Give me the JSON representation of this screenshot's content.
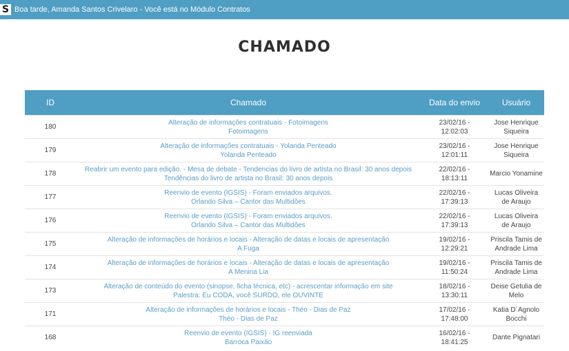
{
  "header": {
    "logo_text": "S",
    "greeting": "Boa tarde, Amanda Santos Crivelaro - Você está no Módulo Contratos"
  },
  "page": {
    "title": "CHAMADO"
  },
  "table": {
    "columns": [
      "ID",
      "Chamado",
      "Data do envio",
      "Usuário"
    ],
    "rows": [
      {
        "id": "180",
        "line1": "Alteração de informações contratuais - Fotoimagens",
        "line2": "Fotoimagens",
        "date": "23/02/16 -",
        "time": "12:02:03",
        "user": "Jose Henrique Siqueira"
      },
      {
        "id": "179",
        "line1": "Alteração de informações contratuais - Yolanda Penteado",
        "line2": "Yolanda Penteado",
        "date": "23/02/16 -",
        "time": "12:01:11",
        "user": "Jose Henrique Siqueira"
      },
      {
        "id": "178",
        "line1": "Reabrir um evento para edição. - Mesa de debate - Tendencias do livro de artista no Brasil: 30 anos depois",
        "line2": "Tendências do livro de artista no Brasil: 30 anos depois",
        "date": "22/02/16 -",
        "time": "18:13:11",
        "user": "Marcio Yonamine"
      },
      {
        "id": "177",
        "line1": "Reenvio de evento (IGSIS) - Foram enviados arquivos.",
        "line2": "Orlando Silva – Cantor das Multidões",
        "date": "22/02/16 -",
        "time": "17:39:13",
        "user": "Lucas Oliveira de Araujo"
      },
      {
        "id": "176",
        "line1": "Reenvio de evento (IGSIS) - Foram enviados arquivos.",
        "line2": "Orlando Silva – Cantor das Multidões",
        "date": "22/02/16 -",
        "time": "17:39:13",
        "user": "Lucas Oliveira de Araujo"
      },
      {
        "id": "175",
        "line1": "Alteração de informações de horários e locais - Alteração de datas e locais de apresentação",
        "line2": "A Fuga",
        "date": "19/02/16 -",
        "time": "12:29:21",
        "user": "Priscila Tamis de Andrade Lima"
      },
      {
        "id": "174",
        "line1": "Alteração de informações de horários e locais - Alteração de datas e locais de apresentação",
        "line2": "A Menina Lia",
        "date": "19/02/16 -",
        "time": "11:50:24",
        "user": "Priscila Tamis de Andrade Lima"
      },
      {
        "id": "173",
        "line1": "Alteração de conteúdo do evento (sinopse, ficha técnica, etc) - acrescentar informação em site",
        "line2": "Palestra: Eu CODA, você SURDO, ele OUVINTE",
        "date": "18/02/16 -",
        "time": "13:30:11",
        "user": "Deise Getulia de Melo"
      },
      {
        "id": "171",
        "line1": "Alteração de informações de horários e locais - Théo - Dias de Paz",
        "line2": "Théo - Dias de Paz",
        "date": "17/02/16 -",
        "time": "17:48:00",
        "user": "Katia D´Agnolo Bocchi"
      },
      {
        "id": "168",
        "line1": "Reenvio de evento (IGSIS) - IG reenviada",
        "line2": "Barroca Paixão",
        "date": "16/02/16 -",
        "time": "18:41:25",
        "user": "Dante Pignatari"
      }
    ]
  },
  "colors": {
    "header_bg": "#4f9ec4",
    "link": "#5a9ec9",
    "title": "#2f2f2f"
  }
}
